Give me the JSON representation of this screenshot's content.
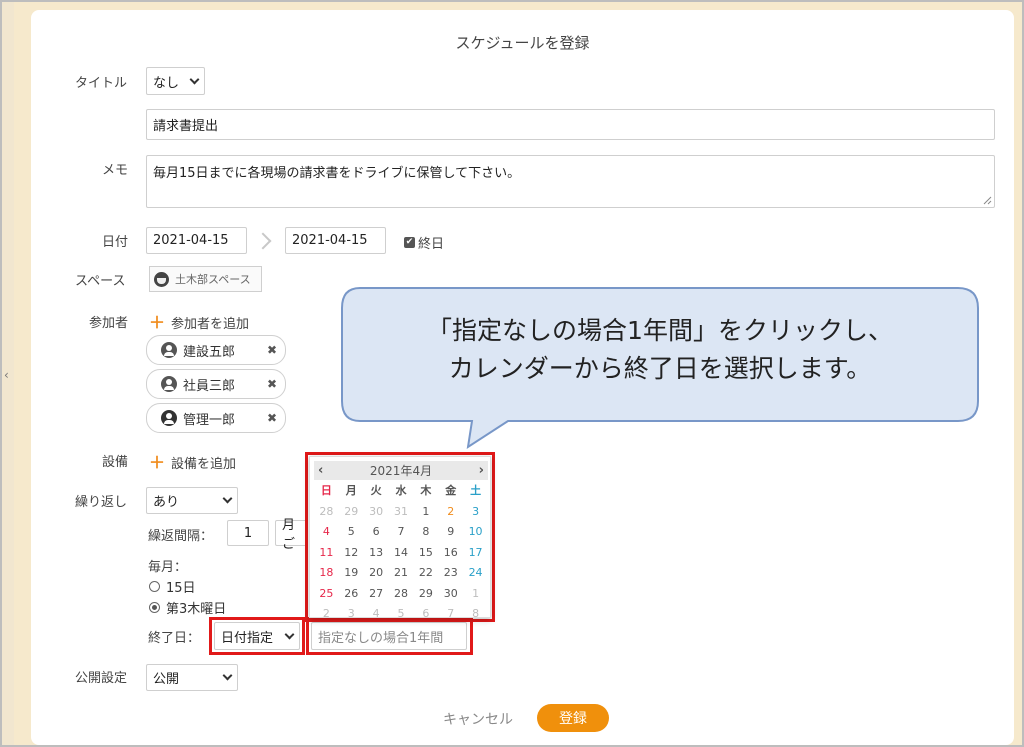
{
  "dialog": {
    "title": "スケジュールを登録",
    "title_label": "タイトル",
    "title_select": "なし",
    "title_value": "請求書提出",
    "memo_label": "メモ",
    "memo_value": "毎月15日までに各現場の請求書をドライブに保管して下さい。",
    "date_label": "日付",
    "date_start": "2021-04-15",
    "date_end": "2021-04-15",
    "allday_label": "終日",
    "space_label": "スペース",
    "space_value": "土木部スペース",
    "participants_label": "参加者",
    "add_participant": "参加者を追加",
    "participants": [
      {
        "name": "建設五郎"
      },
      {
        "name": "社員三郎"
      },
      {
        "name": "管理一郎"
      }
    ],
    "equipment_label": "設備",
    "add_equipment": "設備を追加",
    "repeat_label": "繰り返し",
    "repeat_value": "あり",
    "interval_label": "繰返間隔：",
    "interval_value": "1",
    "interval_unit": "月ご",
    "monthly_label": "毎月：",
    "monthly_option_1": "15日",
    "monthly_option_2": "第3木曜日",
    "end_date_label": "終了日：",
    "end_date_select": "日付指定",
    "end_date_placeholder": "指定なしの場合1年間",
    "publish_label": "公開設定",
    "publish_value": "公開",
    "cancel_label": "キャンセル",
    "submit_label": "登録"
  },
  "calendar": {
    "month_label": "2021年4月",
    "weekdays": [
      "日",
      "月",
      "火",
      "水",
      "木",
      "金",
      "土"
    ],
    "days": [
      "28",
      "29",
      "30",
      "31",
      "1",
      "2",
      "3",
      "4",
      "5",
      "6",
      "7",
      "8",
      "9",
      "10",
      "11",
      "12",
      "13",
      "14",
      "15",
      "16",
      "17",
      "18",
      "19",
      "20",
      "21",
      "22",
      "23",
      "24",
      "25",
      "26",
      "27",
      "28",
      "29",
      "30",
      "1",
      "2",
      "3",
      "4",
      "5",
      "6",
      "7",
      "8"
    ]
  },
  "callout": {
    "line1": "「指定なしの場合1年間」をクリックし、",
    "line2": "カレンダーから終了日を選択します。"
  },
  "colors": {
    "accent": "#f0900c",
    "highlight_box": "#e11919",
    "sunday": "#e6274a",
    "saturday": "#2aa0c8",
    "callout_fill": "#dce6f4",
    "callout_border": "#7897c8"
  },
  "icons": {
    "side_arrow": "chevron-left-icon",
    "prev_month": "chevron-left-icon",
    "next_month": "chevron-right-icon"
  },
  "side_arrow_glyph": "‹",
  "prev_glyph": "‹",
  "next_glyph": "›",
  "remove_glyph": "✖",
  "check_glyph": "✔",
  "plus_glyph": "＋"
}
